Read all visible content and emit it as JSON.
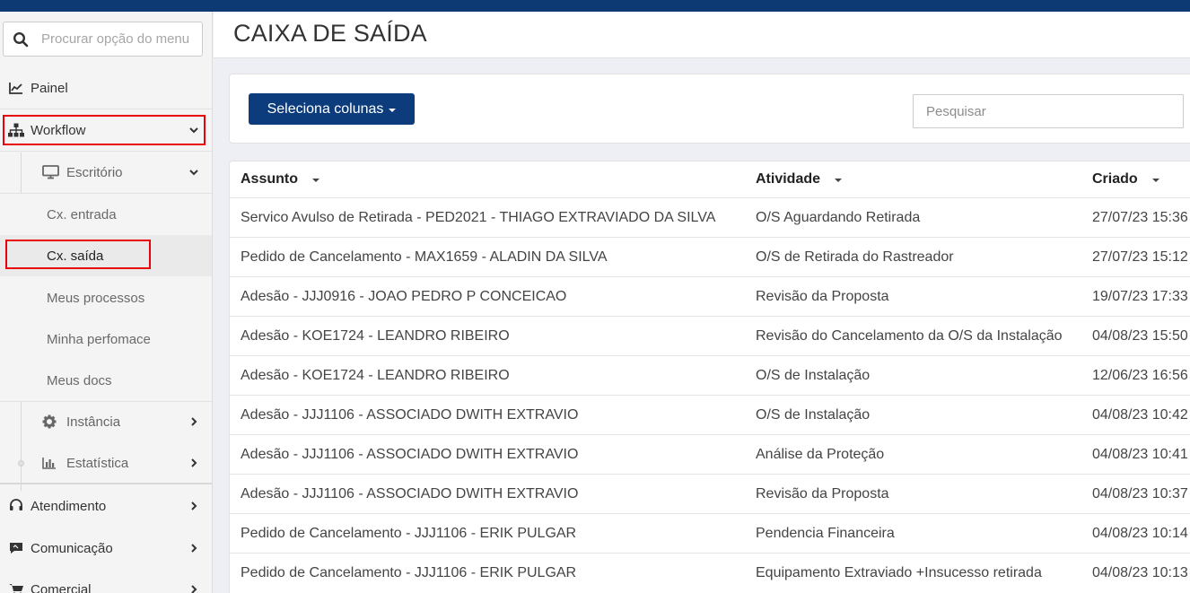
{
  "sidebar": {
    "search_placeholder": "Procurar opção do menu",
    "items": {
      "painel": "Painel",
      "workflow": "Workflow",
      "atendimento": "Atendimento",
      "comunicacao": "Comunicação",
      "comercial": "Comercial"
    },
    "escritorio": {
      "label": "Escritório",
      "children": {
        "entrada": "Cx. entrada",
        "saida": "Cx. saída",
        "processos": "Meus processos",
        "performance": "Minha perfomace",
        "docs": "Meus docs"
      }
    },
    "instancia": "Instância",
    "estatistica": "Estatística"
  },
  "page": {
    "title": "CAIXA DE SAÍDA"
  },
  "toolbar": {
    "select_columns": "Seleciona colunas",
    "search_placeholder": "Pesquisar"
  },
  "table": {
    "columns": {
      "assunto": "Assunto",
      "atividade": "Atividade",
      "criado": "Criado"
    },
    "rows": [
      {
        "assunto": "Servico Avulso de Retirada - PED2021 - THIAGO EXTRAVIADO DA SILVA",
        "atividade": "O/S Aguardando Retirada",
        "criado": "27/07/23 15:36"
      },
      {
        "assunto": "Pedido de Cancelamento - MAX1659 - ALADIN DA SILVA",
        "atividade": "O/S de Retirada do Rastreador",
        "criado": "27/07/23 15:12"
      },
      {
        "assunto": "Adesão - JJJ0916 - JOAO PEDRO P CONCEICAO",
        "atividade": "Revisão da Proposta",
        "criado": "19/07/23 17:33"
      },
      {
        "assunto": "Adesão - KOE1724 - LEANDRO RIBEIRO",
        "atividade": "Revisão do Cancelamento da O/S da Instalação",
        "criado": "04/08/23 15:50"
      },
      {
        "assunto": "Adesão - KOE1724 - LEANDRO RIBEIRO",
        "atividade": "O/S de Instalação",
        "criado": "12/06/23 16:56"
      },
      {
        "assunto": "Adesão - JJJ1106 - ASSOCIADO DWITH EXTRAVIO",
        "atividade": "O/S de Instalação",
        "criado": "04/08/23 10:42"
      },
      {
        "assunto": "Adesão - JJJ1106 - ASSOCIADO DWITH EXTRAVIO",
        "atividade": "Análise da Proteção",
        "criado": "04/08/23 10:41"
      },
      {
        "assunto": "Adesão - JJJ1106 - ASSOCIADO DWITH EXTRAVIO",
        "atividade": "Revisão da Proposta",
        "criado": "04/08/23 10:37"
      },
      {
        "assunto": "Pedido de Cancelamento - JJJ1106 - ERIK PULGAR",
        "atividade": "Pendencia Financeira",
        "criado": "04/08/23 10:14"
      },
      {
        "assunto": "Pedido de Cancelamento - JJJ1106 - ERIK PULGAR",
        "atividade": "Equipamento Extraviado +Insucesso retirada",
        "criado": "04/08/23 10:13"
      }
    ]
  },
  "colors": {
    "brand": "#0d3c7c",
    "highlight": "#e8000b"
  }
}
